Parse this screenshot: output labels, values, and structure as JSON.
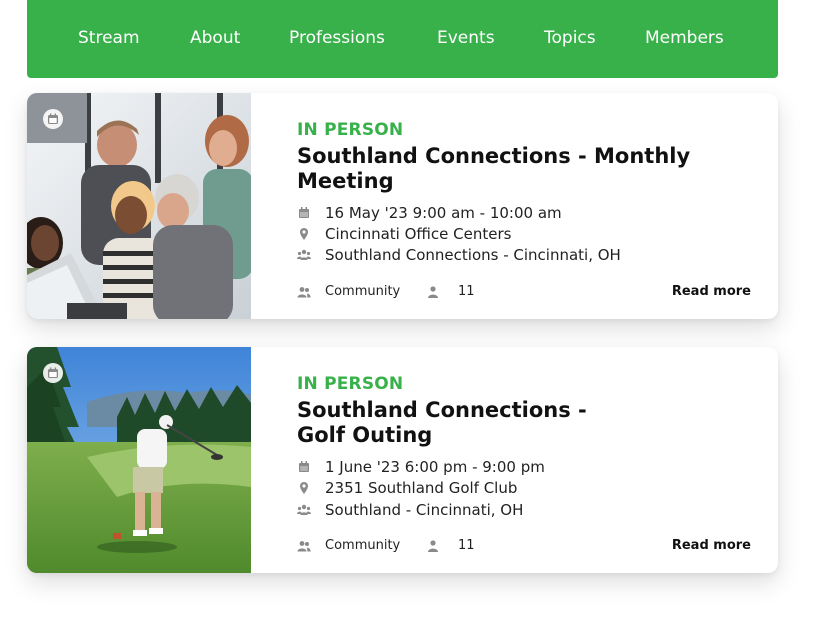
{
  "nav": {
    "items": [
      "Stream",
      "About",
      "Professions",
      "Events",
      "Topics",
      "Members"
    ]
  },
  "colors": {
    "brand_green": "#38b14b",
    "icon_gray": "#8a8a8a"
  },
  "events": [
    {
      "kind": "IN PERSON",
      "title": "Southland Connections - Monthly Meeting",
      "date": "16 May '23 9:00 am - 10:00 am",
      "location": "Cincinnati Office Centers",
      "group": "Southland Connections - Cincinnati, OH",
      "category": "Community",
      "attendees": "11",
      "read_more": "Read more",
      "image_icon": "calendar-icon"
    },
    {
      "kind": "IN PERSON",
      "title": "Southland Connections - Golf Outing",
      "date": "1 June '23 6:00 pm - 9:00 pm",
      "location": "2351 Southland Golf Club",
      "group": "Southland - Cincinnati, OH",
      "category": "Community",
      "attendees": "11",
      "read_more": "Read more",
      "image_icon": "calendar-icon"
    }
  ]
}
